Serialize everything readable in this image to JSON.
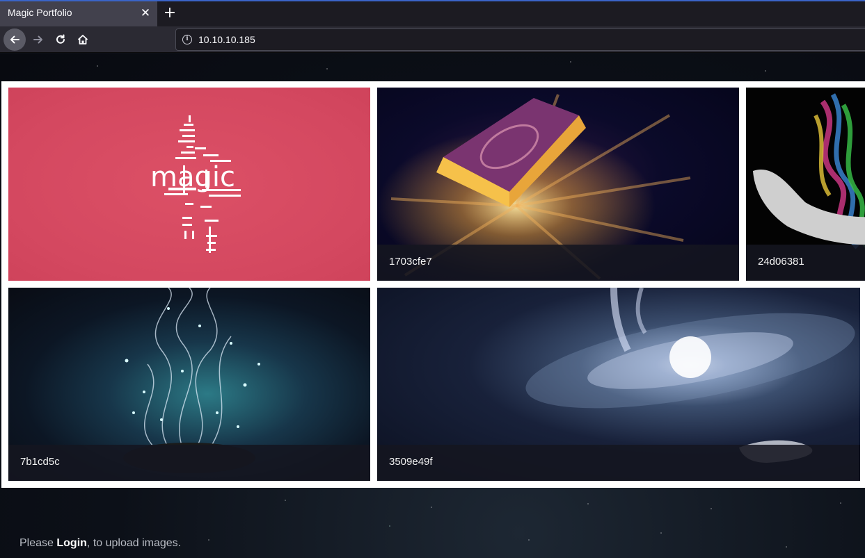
{
  "browser": {
    "tab_title": "Magic Portfolio",
    "url": "10.10.10.185"
  },
  "gallery": {
    "cards": [
      {
        "caption": "",
        "image_alt": "magic logo"
      },
      {
        "caption": "1703cfe7",
        "image_alt": "glowing book"
      },
      {
        "caption": "24d06381",
        "image_alt": "hand with rainbow smoke"
      },
      {
        "caption": "7b1cd5c",
        "image_alt": "magic hat sparkles"
      },
      {
        "caption": "3509e49f",
        "image_alt": "galaxy in hand"
      }
    ],
    "logo_text": "magic"
  },
  "footer": {
    "prefix": "Please ",
    "login_link": "Login",
    "suffix": ", to upload images."
  }
}
